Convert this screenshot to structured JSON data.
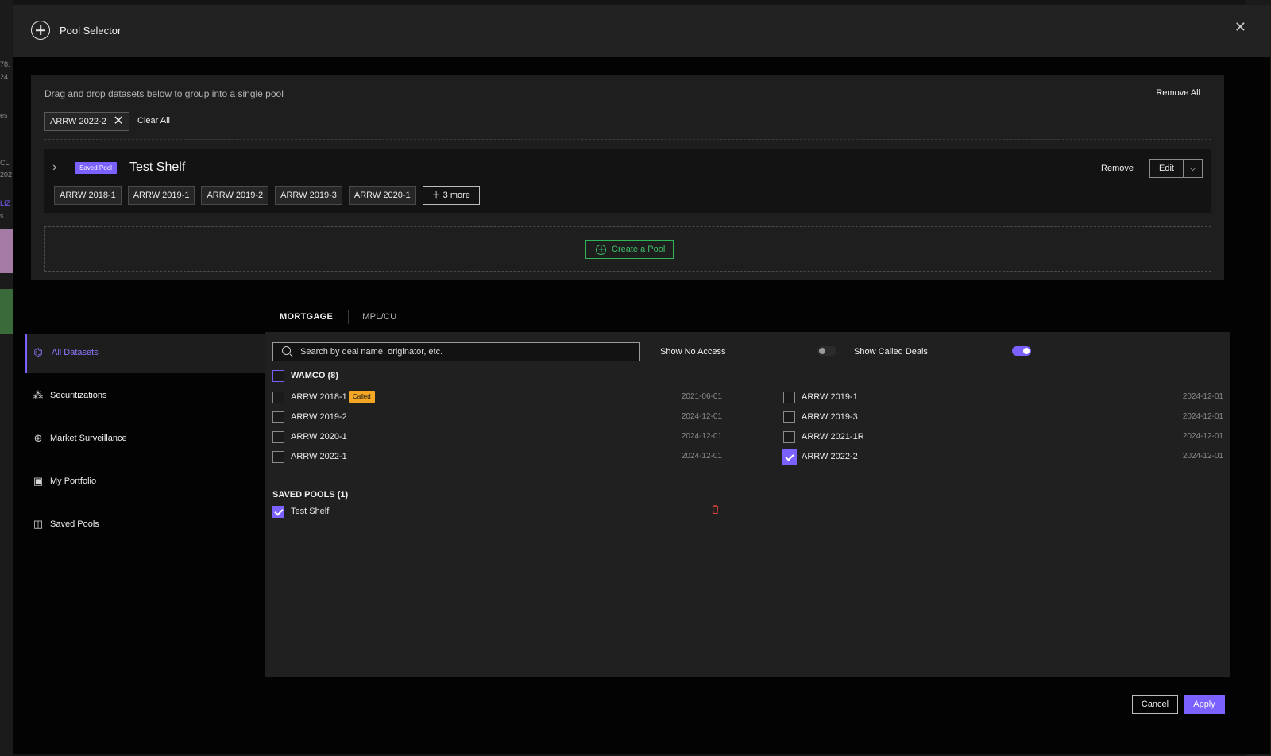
{
  "modal": {
    "title": "Pool Selector"
  },
  "pool_area": {
    "hint": "Drag and drop datasets below to group into a single pool",
    "remove_all": "Remove All",
    "selected_chip": "ARRW 2022-2",
    "clear_all": "Clear All",
    "create_pool": "Create a Pool"
  },
  "shelf": {
    "badge": "Saved Pool",
    "name": "Test Shelf",
    "remove": "Remove",
    "edit": "Edit",
    "chips": [
      "ARRW 2018-1",
      "ARRW 2019-1",
      "ARRW 2019-2",
      "ARRW 2019-3",
      "ARRW 2020-1"
    ],
    "more": "3 more"
  },
  "tabs": [
    "MORTGAGE",
    "MPL/CU"
  ],
  "sidebar": {
    "items": [
      {
        "label": "All Datasets",
        "icon": "puzzle-icon"
      },
      {
        "label": "Securitizations",
        "icon": "network-icon"
      },
      {
        "label": "Market Surveillance",
        "icon": "zoom-in-icon"
      },
      {
        "label": "My Portfolio",
        "icon": "briefcase-icon"
      },
      {
        "label": "Saved Pools",
        "icon": "save-icon"
      }
    ]
  },
  "filters": {
    "search_placeholder": "Search by deal name, originator, etc.",
    "show_no_access": "Show No Access",
    "show_no_access_on": false,
    "show_called_deals": "Show Called Deals",
    "show_called_deals_on": true
  },
  "group": {
    "label": "WAMCO (8)",
    "called_badge": "Called",
    "left": [
      {
        "name": "ARRW 2018-1",
        "date": "2021-06-01",
        "checked": false,
        "called": true
      },
      {
        "name": "ARRW 2019-2",
        "date": "2024-12-01",
        "checked": false
      },
      {
        "name": "ARRW 2020-1",
        "date": "2024-12-01",
        "checked": false
      },
      {
        "name": "ARRW 2022-1",
        "date": "2024-12-01",
        "checked": false
      }
    ],
    "right": [
      {
        "name": "ARRW 2019-1",
        "date": "2024-12-01",
        "checked": false
      },
      {
        "name": "ARRW 2019-3",
        "date": "2024-12-01",
        "checked": false
      },
      {
        "name": "ARRW 2021-1R",
        "date": "2024-12-01",
        "checked": false
      },
      {
        "name": "ARRW 2022-2",
        "date": "2024-12-01",
        "checked": true
      }
    ]
  },
  "saved_pools": {
    "label": "SAVED POOLS (1)",
    "items": [
      {
        "name": "Test Shelf",
        "checked": true
      }
    ]
  },
  "footer": {
    "cancel": "Cancel",
    "apply": "Apply"
  },
  "colors": {
    "accent": "#7b61ff",
    "green": "#3dc268",
    "called": "#f5a623",
    "danger": "#e0443c"
  },
  "background": {
    "fragments": [
      "78.",
      "24.",
      "es",
      "CL",
      "202",
      "LIZ",
      "s"
    ]
  }
}
